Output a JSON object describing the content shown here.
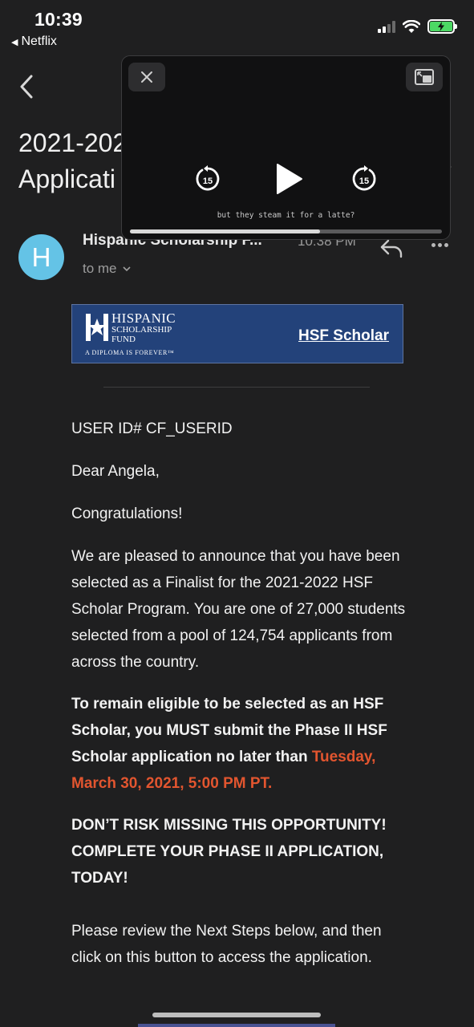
{
  "status_bar": {
    "time": "10:39",
    "back_app": "Netflix",
    "battery_color": "#4cd964"
  },
  "email": {
    "subject_line1": "2021-202",
    "subject_line2": "Applicati",
    "avatar_letter": "H",
    "avatar_color": "#64c3e6",
    "sender": "Hispanic Scholarship F...",
    "time": "10:38 PM",
    "to": "to me"
  },
  "banner": {
    "org_line1": "HISPANIC",
    "org_line2": "SCHOLARSHIP",
    "org_line3": "FUND",
    "tagline": "A DIPLOMA IS FOREVER™",
    "link": "HSF Scholar",
    "bg_color": "#23427a"
  },
  "body": {
    "user_id": "USER ID# CF_USERID",
    "greeting": "Dear Angela,",
    "congrats": "Congratulations!",
    "para1": "We are pleased to announce that you have been selected as a Finalist for the 2021-2022 HSF Scholar Program. You are one of 27,000 students selected from a pool of 124,754 applicants from across the country.",
    "para2": "To remain eligible to be selected as an HSF Scholar, you MUST submit the Phase II HSF Scholar application no later than",
    "deadline": "Tuesday, March 30, 2021, 5:00 PM PT.",
    "deadline_color": "#e2552f",
    "para3": "DON’T RISK MISSING THIS OPPORTUNITY! COMPLETE YOUR PHASE II APPLICATION, TODAY!",
    "para4": "Please review the Next Steps below, and then click on this button to access the application."
  },
  "pip": {
    "skip_back": "15",
    "skip_forward": "15",
    "caption": "but they steam it for a latte?",
    "progress": 0.61
  }
}
